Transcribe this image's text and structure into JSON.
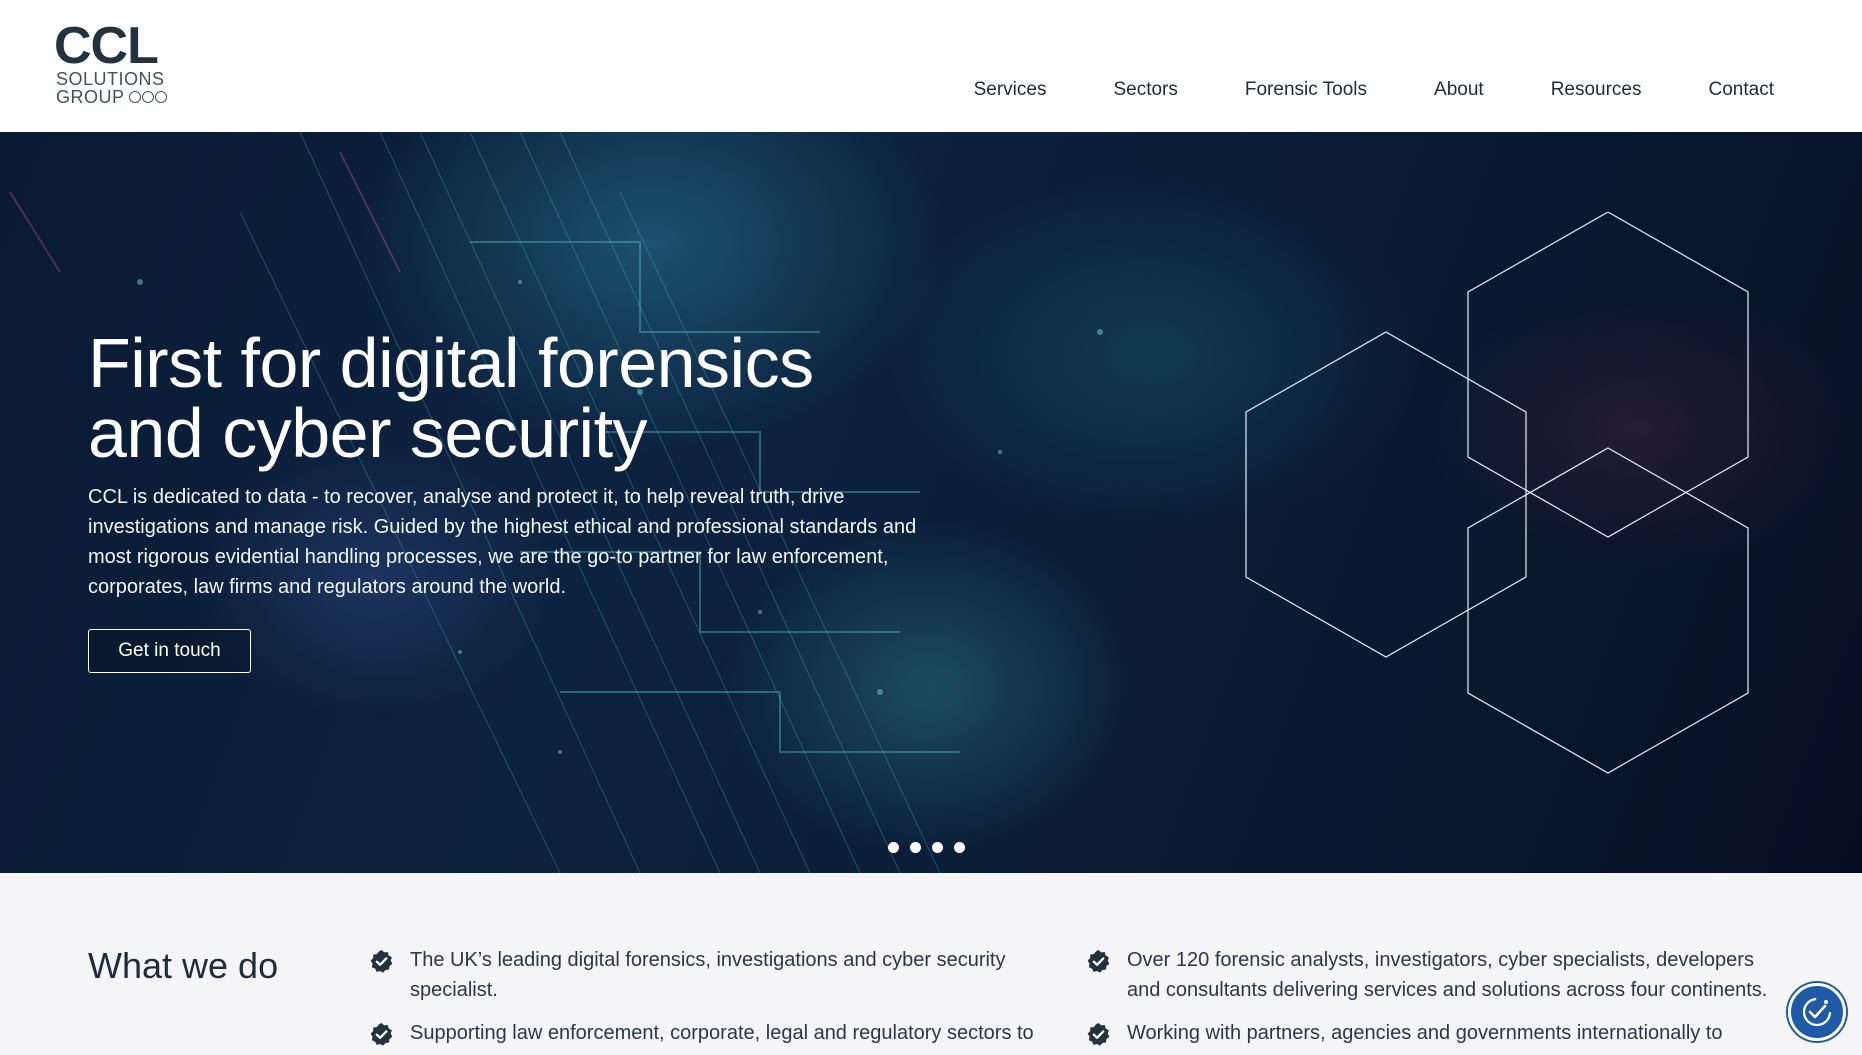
{
  "header": {
    "logo": {
      "main": "CCL",
      "line1": "SOLUTIONS",
      "line2": "GROUP"
    },
    "nav": [
      "Services",
      "Sectors",
      "Forensic Tools",
      "About",
      "Resources",
      "Contact"
    ]
  },
  "hero": {
    "title_line1": "First for digital forensics",
    "title_line2": "and cyber security",
    "description": "CCL is dedicated to data - to recover, analyse and protect it, to help reveal truth, drive investigations and manage risk. Guided by the highest ethical and professional standards and most rigorous evidential handling processes, we are the go-to partner for law enforcement, corporates, law firms and regulators around the world.",
    "cta_label": "Get in touch",
    "slide_count": 4
  },
  "what_we_do": {
    "title": "What we do",
    "items": [
      "The UK’s leading digital forensics, investigations and cyber security specialist.",
      "Over 120 forensic analysts, investigators, cyber specialists, developers and consultants delivering services and solutions across four continents.",
      "Supporting law enforcement, corporate, legal and regulatory sectors to",
      "Working with partners, agencies and governments internationally to"
    ]
  },
  "icons": {
    "check": "check-badge-icon",
    "accessibility": "accessibility-icon"
  },
  "colors": {
    "nav_text": "#1e2d3a",
    "hero_bg": "#0c2340",
    "section_bg": "#f5f4f7",
    "check_badge": "#22333f",
    "accessibility_button": "#1f5aa6"
  }
}
